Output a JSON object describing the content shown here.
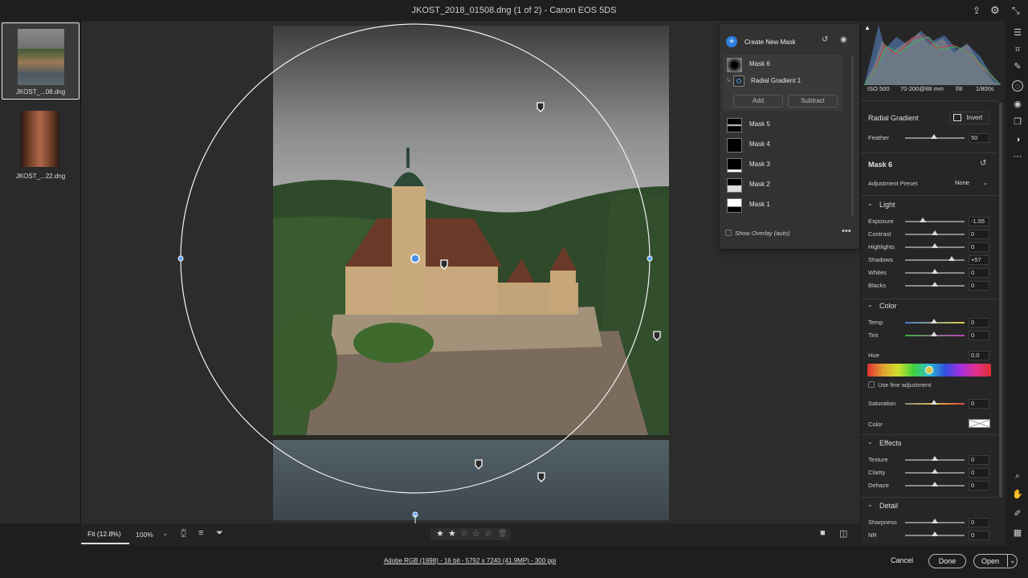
{
  "window": {
    "title": "JKOST_2018_01508.dng (1 of 2)  -  Canon EOS 5DS"
  },
  "filmstrip": {
    "items": [
      {
        "name": "JKOST_...08.dng",
        "selected": true
      },
      {
        "name": "JKOST_...22.dng",
        "selected": false
      }
    ]
  },
  "mask_panel": {
    "create_label": "Create New Mask",
    "masks": [
      {
        "name": "Mask 6"
      },
      {
        "name": "Radial Gradient 1"
      },
      {
        "name": "Mask 5"
      },
      {
        "name": "Mask 4"
      },
      {
        "name": "Mask 3"
      },
      {
        "name": "Mask 2"
      },
      {
        "name": "Mask 1"
      }
    ],
    "add_label": "Add",
    "subtract_label": "Subtract",
    "overlay_label": "Show Overlay (auto)"
  },
  "exif": {
    "iso": "ISO 500",
    "lens": "70-200@88 mm",
    "aperture": "f/8",
    "shutter": "1/800s"
  },
  "properties": {
    "tool_title": "Radial Gradient",
    "invert_label": "Invert",
    "feather_label": "Feather",
    "feather_value": "50",
    "mask_title": "Mask 6",
    "preset_label": "Adjustment Preset",
    "preset_value": "None",
    "light": {
      "title": "Light",
      "rows": [
        {
          "label": "Exposure",
          "value": "-1.55",
          "pos": 0.3
        },
        {
          "label": "Contrast",
          "value": "0",
          "pos": 0.5
        },
        {
          "label": "Highlights",
          "value": "0",
          "pos": 0.5
        },
        {
          "label": "Shadows",
          "value": "+57",
          "pos": 0.78
        },
        {
          "label": "Whites",
          "value": "0",
          "pos": 0.5
        },
        {
          "label": "Blacks",
          "value": "0",
          "pos": 0.5
        }
      ]
    },
    "color": {
      "title": "Color",
      "temp_label": "Temp",
      "temp_value": "0",
      "tint_label": "Tint",
      "tint_value": "0",
      "hue_label": "Hue",
      "hue_value": "0.0",
      "fine_label": "Use fine adjustment",
      "saturation_label": "Saturation",
      "saturation_value": "0",
      "color_label": "Color"
    },
    "effects": {
      "title": "Effects",
      "rows": [
        {
          "label": "Texture",
          "value": "0",
          "pos": 0.5
        },
        {
          "label": "Clarity",
          "value": "0",
          "pos": 0.5
        },
        {
          "label": "Dehaze",
          "value": "0",
          "pos": 0.5
        }
      ]
    },
    "detail": {
      "title": "Detail",
      "rows": [
        {
          "label": "Sharpness",
          "value": "0",
          "pos": 0.5
        },
        {
          "label": "NR",
          "value": "0",
          "pos": 0.5
        }
      ]
    }
  },
  "bottom": {
    "fit_label": "Fit (12.8%)",
    "zoom_label": "100%"
  },
  "status": {
    "info": "Adobe RGB (1998) - 16 bit - 5792 x 7240 (41.9MP) - 300 ppi",
    "cancel": "Cancel",
    "done": "Done",
    "open": "Open"
  }
}
